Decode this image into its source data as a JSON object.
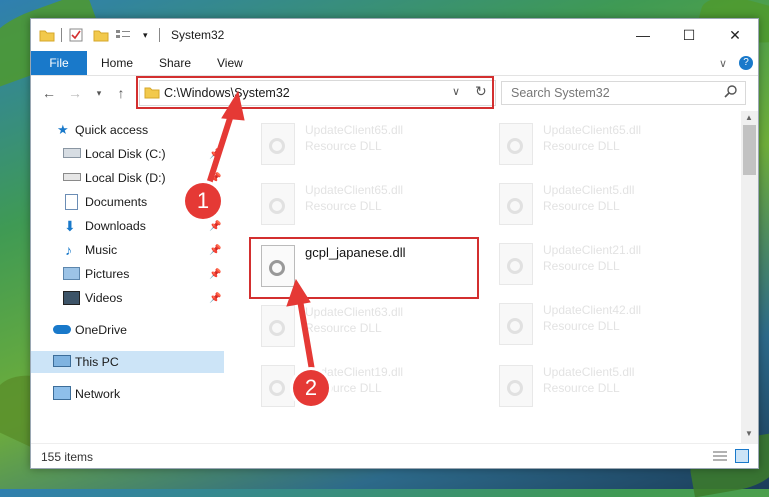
{
  "window": {
    "title": "System32",
    "minimize_glyph": "—",
    "maximize_glyph": "☐",
    "close_glyph": "✕"
  },
  "ribbon": {
    "tabs": [
      {
        "label": "File"
      },
      {
        "label": "Home"
      },
      {
        "label": "Share"
      },
      {
        "label": "View"
      }
    ],
    "help_glyph": "?",
    "collapse_glyph": "∨"
  },
  "address": {
    "path": "C:\\Windows\\System32",
    "dropdown_glyph": "∨",
    "refresh_glyph": "↻"
  },
  "search": {
    "placeholder": "Search System32",
    "icon": "search-icon"
  },
  "sidebar": {
    "items": [
      {
        "label": "Quick access",
        "icon": "star-icon"
      },
      {
        "label": "Local Disk (C:)",
        "icon": "drive-icon"
      },
      {
        "label": "Local Disk (D:)",
        "icon": "drive-icon"
      },
      {
        "label": "Documents",
        "icon": "documents-icon"
      },
      {
        "label": "Downloads",
        "icon": "downloads-icon"
      },
      {
        "label": "Music",
        "icon": "music-icon"
      },
      {
        "label": "Pictures",
        "icon": "pictures-icon"
      },
      {
        "label": "Videos",
        "icon": "videos-icon"
      },
      {
        "label": "OneDrive",
        "icon": "cloud-icon"
      },
      {
        "label": "This PC",
        "icon": "computer-icon"
      },
      {
        "label": "Network",
        "icon": "network-icon"
      }
    ]
  },
  "files": {
    "left_column": [
      {
        "name": "UpdateClient65.dll",
        "type": "Resource DLL"
      },
      {
        "name": "UpdateClient65.dll",
        "type": "Resource DLL"
      },
      {
        "name": "gcpl_japanese.dll",
        "type": ""
      },
      {
        "name": "UpdateClient63.dll",
        "type": "Resource DLL"
      },
      {
        "name": "UpdateClient19.dll",
        "type": "Resource DLL"
      }
    ],
    "right_column": [
      {
        "name": "UpdateClient65.dll",
        "type": "Resource DLL"
      },
      {
        "name": "UpdateClient5.dll",
        "type": "Resource DLL"
      },
      {
        "name": "UpdateClient21.dll",
        "type": "Resource DLL"
      },
      {
        "name": "UpdateClient42.dll",
        "type": "Resource DLL"
      },
      {
        "name": "UpdateClient5.dll",
        "type": "Resource DLL"
      }
    ]
  },
  "status": {
    "item_count": "155 items"
  },
  "annotations": {
    "badge1": "1",
    "badge2": "2",
    "highlight_color": "#d32f2f"
  },
  "colors": {
    "accent": "#1979ca",
    "selected": "#cce4f7"
  }
}
